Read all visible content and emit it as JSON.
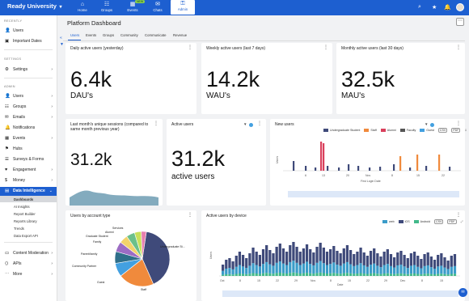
{
  "topbar": {
    "brand": "Ready University",
    "nav": [
      {
        "icon": "home-icon",
        "glyph": "⌂",
        "label": "Home"
      },
      {
        "icon": "groups-icon",
        "glyph": "☷",
        "label": "Groups"
      },
      {
        "icon": "events-icon",
        "glyph": "▦",
        "label": "Events",
        "badge": "NEW"
      },
      {
        "icon": "chats-icon",
        "glyph": "✉",
        "label": "Chats"
      },
      {
        "icon": "admin-icon",
        "glyph": "⚿",
        "label": "Admin"
      }
    ]
  },
  "sidebar": {
    "recently_label": "RECENTLY",
    "recently": [
      {
        "label": "Users",
        "glyph": "👤"
      },
      {
        "label": "Important Dates",
        "glyph": "▣"
      }
    ],
    "settings_label": "SETTINGS",
    "settings": [
      {
        "label": "Settings",
        "glyph": "⚙"
      }
    ],
    "admin_label": "ADMIN",
    "admin": [
      {
        "label": "Users",
        "glyph": "👤"
      },
      {
        "label": "Groups",
        "glyph": "☷"
      },
      {
        "label": "Emails",
        "glyph": "✉"
      },
      {
        "label": "Notifications",
        "glyph": "🔔"
      },
      {
        "label": "Events",
        "glyph": "▦"
      },
      {
        "label": "Hubs",
        "glyph": "⚑"
      },
      {
        "label": "Surveys & Forms",
        "glyph": "☰"
      },
      {
        "label": "Engagement",
        "glyph": "♥"
      },
      {
        "label": "Money",
        "glyph": "$"
      },
      {
        "label": "Data Intelligence",
        "glyph": "▤"
      }
    ],
    "data_intelligence_sub": [
      "Dashboards",
      "AI Insights",
      "Report Builder",
      "Reports Library",
      "Trends",
      "Data Export API"
    ],
    "bottom": [
      {
        "label": "Content Moderation",
        "glyph": "▭"
      },
      {
        "label": "APIs",
        "glyph": "⟨⟩"
      },
      {
        "label": "More",
        "glyph": "⋯"
      }
    ]
  },
  "page": {
    "title": "Platform Dashboard",
    "more": "⋯",
    "tabs": [
      "Users",
      "Events",
      "Groups",
      "Community",
      "Communicate",
      "Revenue"
    ]
  },
  "cards": {
    "dau": {
      "title": "Daily active users (yesterday)",
      "value": "6.4k",
      "unit": "DAU's"
    },
    "wau": {
      "title": "Weekly active users (last 7 days)",
      "value": "14.2k",
      "unit": "WAU's"
    },
    "mau": {
      "title": "Monthly active users (last 30 days)",
      "value": "32.5k",
      "unit": "MAU's"
    },
    "sessions": {
      "title": "Last month's unique sessions (compared to same month previous year)",
      "value": "31.2k"
    },
    "active": {
      "title": "Active users",
      "value": "31.2k",
      "unit": "active users"
    },
    "new_users": {
      "title": "New users",
      "legend": [
        "Undergraduate Student",
        "Staff",
        "Alumni",
        "Faculty",
        "Guest"
      ],
      "controls": [
        "CSV",
        "PDF"
      ],
      "ylabel": "Users",
      "xlabel": "First Login Date",
      "xticks": [
        "6",
        "13",
        "20",
        "Nov",
        "8",
        "15",
        "22"
      ]
    },
    "account_type": {
      "title": "Users by account type",
      "labels": [
        "Services",
        "Alumni",
        "Graduate Student",
        "Family",
        "Parent/family",
        "Community Partner",
        "Guest",
        "Staff",
        "Undergraduate St..."
      ]
    },
    "device": {
      "title": "Active users by device",
      "legend": [
        "web",
        "iOS",
        "Android"
      ],
      "controls": [
        "CSV",
        "PDF"
      ],
      "ylabel": "Users",
      "xlabel": "Date",
      "xticks": [
        "Oct",
        "8",
        "15",
        "22",
        "29",
        "Nov",
        "8",
        "15",
        "22",
        "29",
        "Dec",
        "8",
        "15"
      ]
    }
  },
  "colors": {
    "primary": "#1d5fd0",
    "undergrad": "#3f4a7a",
    "staff": "#f08a3c",
    "alumni": "#d9405c",
    "faculty": "#555555",
    "guest": "#43a0e0",
    "web": "#3b9cc9",
    "ios": "#3f4a7a",
    "android": "#42b98a"
  }
}
